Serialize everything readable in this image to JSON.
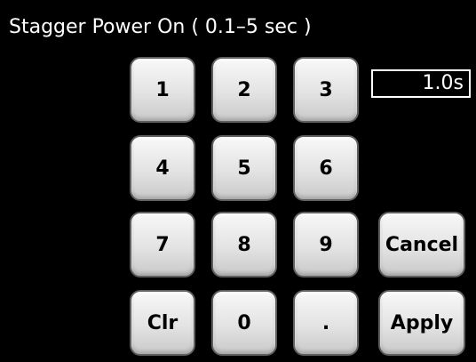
{
  "title": "Stagger Power On ( 0.1–5 sec )",
  "display": {
    "value": "1.0s"
  },
  "keypad": {
    "k1": "1",
    "k2": "2",
    "k3": "3",
    "k4": "4",
    "k5": "5",
    "k6": "6",
    "k7": "7",
    "k8": "8",
    "k9": "9",
    "clr": "Clr",
    "k0": "0",
    "dot": ".",
    "cancel": "Cancel",
    "apply": "Apply"
  }
}
